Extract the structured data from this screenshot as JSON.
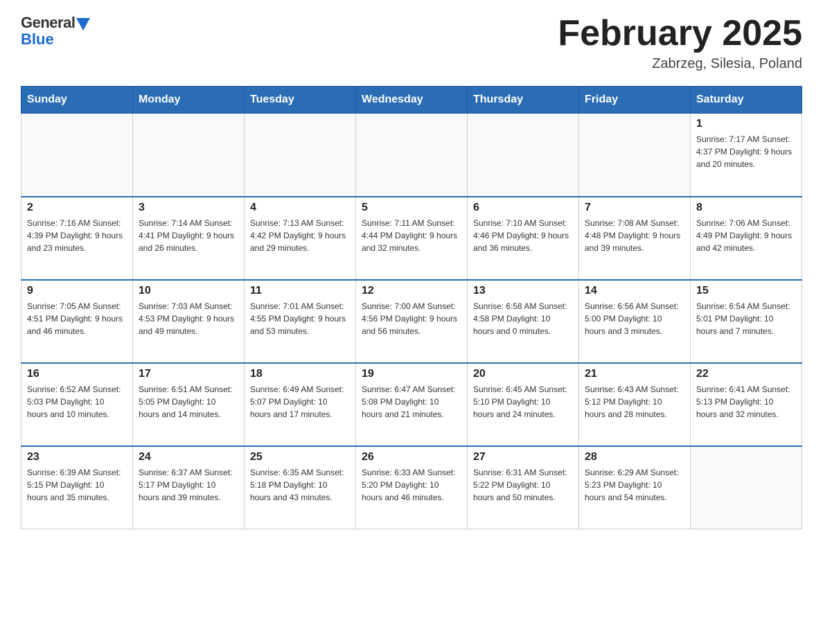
{
  "header": {
    "logo_general": "General",
    "logo_blue": "Blue",
    "month_title": "February 2025",
    "location": "Zabrzeg, Silesia, Poland"
  },
  "days_of_week": [
    "Sunday",
    "Monday",
    "Tuesday",
    "Wednesday",
    "Thursday",
    "Friday",
    "Saturday"
  ],
  "weeks": [
    [
      {
        "day": "",
        "info": ""
      },
      {
        "day": "",
        "info": ""
      },
      {
        "day": "",
        "info": ""
      },
      {
        "day": "",
        "info": ""
      },
      {
        "day": "",
        "info": ""
      },
      {
        "day": "",
        "info": ""
      },
      {
        "day": "1",
        "info": "Sunrise: 7:17 AM\nSunset: 4:37 PM\nDaylight: 9 hours and 20 minutes."
      }
    ],
    [
      {
        "day": "2",
        "info": "Sunrise: 7:16 AM\nSunset: 4:39 PM\nDaylight: 9 hours and 23 minutes."
      },
      {
        "day": "3",
        "info": "Sunrise: 7:14 AM\nSunset: 4:41 PM\nDaylight: 9 hours and 26 minutes."
      },
      {
        "day": "4",
        "info": "Sunrise: 7:13 AM\nSunset: 4:42 PM\nDaylight: 9 hours and 29 minutes."
      },
      {
        "day": "5",
        "info": "Sunrise: 7:11 AM\nSunset: 4:44 PM\nDaylight: 9 hours and 32 minutes."
      },
      {
        "day": "6",
        "info": "Sunrise: 7:10 AM\nSunset: 4:46 PM\nDaylight: 9 hours and 36 minutes."
      },
      {
        "day": "7",
        "info": "Sunrise: 7:08 AM\nSunset: 4:48 PM\nDaylight: 9 hours and 39 minutes."
      },
      {
        "day": "8",
        "info": "Sunrise: 7:06 AM\nSunset: 4:49 PM\nDaylight: 9 hours and 42 minutes."
      }
    ],
    [
      {
        "day": "9",
        "info": "Sunrise: 7:05 AM\nSunset: 4:51 PM\nDaylight: 9 hours and 46 minutes."
      },
      {
        "day": "10",
        "info": "Sunrise: 7:03 AM\nSunset: 4:53 PM\nDaylight: 9 hours and 49 minutes."
      },
      {
        "day": "11",
        "info": "Sunrise: 7:01 AM\nSunset: 4:55 PM\nDaylight: 9 hours and 53 minutes."
      },
      {
        "day": "12",
        "info": "Sunrise: 7:00 AM\nSunset: 4:56 PM\nDaylight: 9 hours and 56 minutes."
      },
      {
        "day": "13",
        "info": "Sunrise: 6:58 AM\nSunset: 4:58 PM\nDaylight: 10 hours and 0 minutes."
      },
      {
        "day": "14",
        "info": "Sunrise: 6:56 AM\nSunset: 5:00 PM\nDaylight: 10 hours and 3 minutes."
      },
      {
        "day": "15",
        "info": "Sunrise: 6:54 AM\nSunset: 5:01 PM\nDaylight: 10 hours and 7 minutes."
      }
    ],
    [
      {
        "day": "16",
        "info": "Sunrise: 6:52 AM\nSunset: 5:03 PM\nDaylight: 10 hours and 10 minutes."
      },
      {
        "day": "17",
        "info": "Sunrise: 6:51 AM\nSunset: 5:05 PM\nDaylight: 10 hours and 14 minutes."
      },
      {
        "day": "18",
        "info": "Sunrise: 6:49 AM\nSunset: 5:07 PM\nDaylight: 10 hours and 17 minutes."
      },
      {
        "day": "19",
        "info": "Sunrise: 6:47 AM\nSunset: 5:08 PM\nDaylight: 10 hours and 21 minutes."
      },
      {
        "day": "20",
        "info": "Sunrise: 6:45 AM\nSunset: 5:10 PM\nDaylight: 10 hours and 24 minutes."
      },
      {
        "day": "21",
        "info": "Sunrise: 6:43 AM\nSunset: 5:12 PM\nDaylight: 10 hours and 28 minutes."
      },
      {
        "day": "22",
        "info": "Sunrise: 6:41 AM\nSunset: 5:13 PM\nDaylight: 10 hours and 32 minutes."
      }
    ],
    [
      {
        "day": "23",
        "info": "Sunrise: 6:39 AM\nSunset: 5:15 PM\nDaylight: 10 hours and 35 minutes."
      },
      {
        "day": "24",
        "info": "Sunrise: 6:37 AM\nSunset: 5:17 PM\nDaylight: 10 hours and 39 minutes."
      },
      {
        "day": "25",
        "info": "Sunrise: 6:35 AM\nSunset: 5:18 PM\nDaylight: 10 hours and 43 minutes."
      },
      {
        "day": "26",
        "info": "Sunrise: 6:33 AM\nSunset: 5:20 PM\nDaylight: 10 hours and 46 minutes."
      },
      {
        "day": "27",
        "info": "Sunrise: 6:31 AM\nSunset: 5:22 PM\nDaylight: 10 hours and 50 minutes."
      },
      {
        "day": "28",
        "info": "Sunrise: 6:29 AM\nSunset: 5:23 PM\nDaylight: 10 hours and 54 minutes."
      },
      {
        "day": "",
        "info": ""
      }
    ]
  ]
}
